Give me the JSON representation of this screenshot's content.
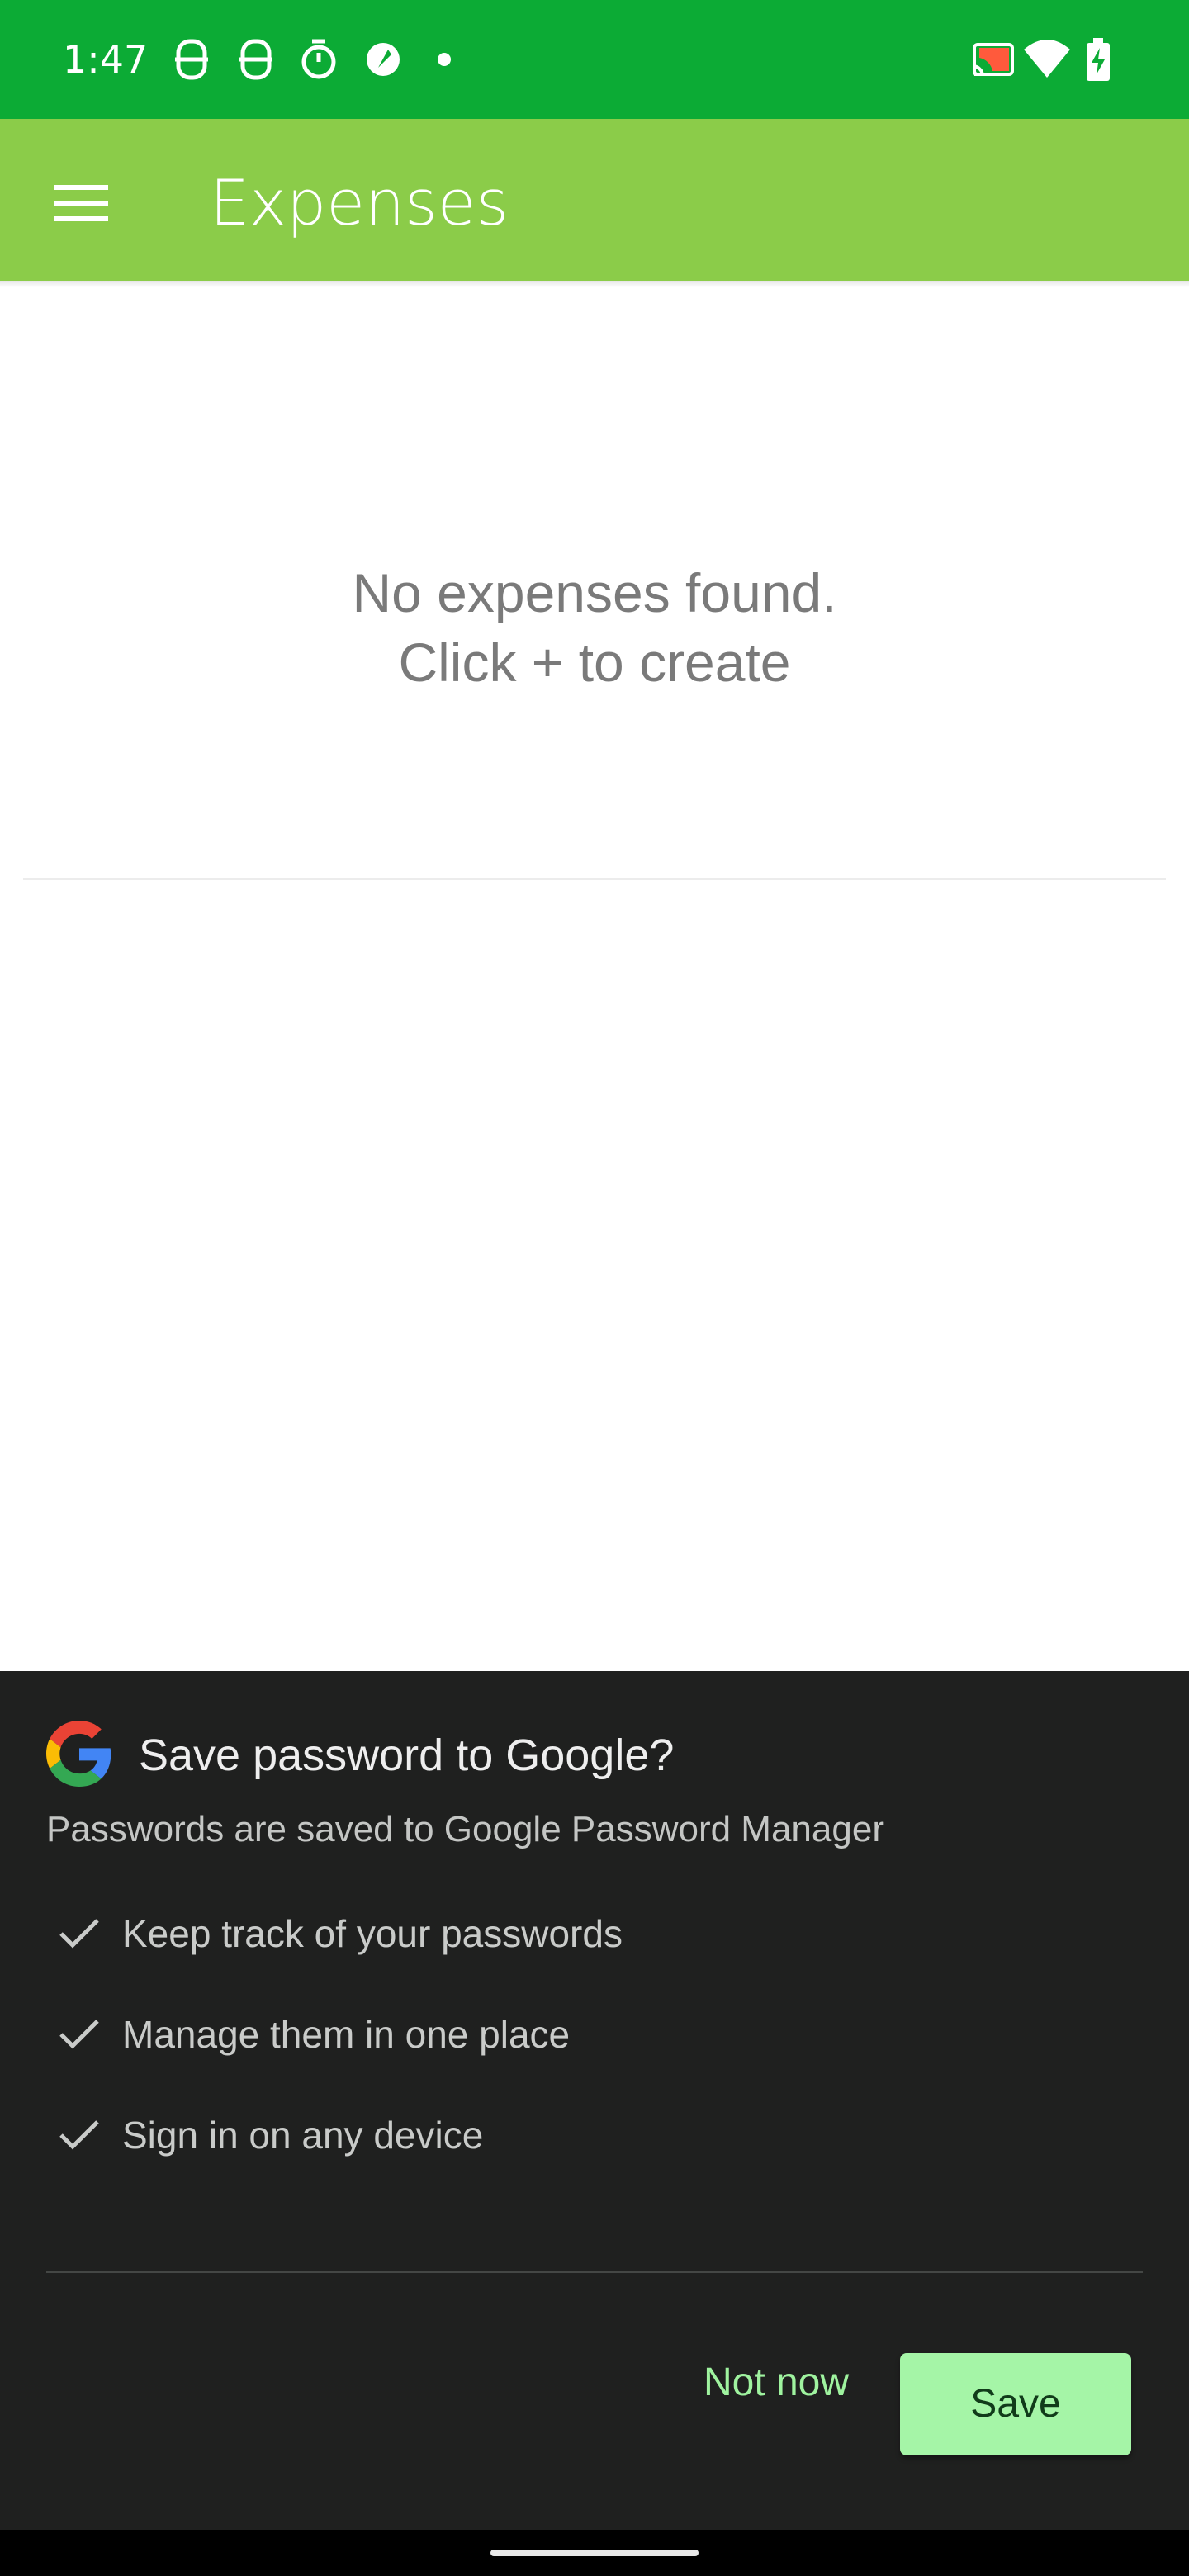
{
  "status_bar": {
    "time": "1:47",
    "background": "#0cab35",
    "icons": [
      "notification-s-icon",
      "notification-s-icon",
      "timer-icon",
      "app-notification-icon",
      "dot-icon",
      "cast-icon",
      "wifi-icon",
      "battery-charging-icon"
    ]
  },
  "app_bar": {
    "title": "Expenses",
    "background": "#8bcc49",
    "menu_icon": "hamburger-menu-icon"
  },
  "empty_state": {
    "line1": "No expenses found.",
    "line2": "Click + to create"
  },
  "password_sheet": {
    "title": "Save password to Google?",
    "subtitle": "Passwords are saved to Google Password Manager",
    "features": [
      "Keep track of your passwords",
      "Manage them in one place",
      "Sign in on any device"
    ],
    "not_now_label": "Not now",
    "save_label": "Save",
    "accent": "#a5f5a7",
    "background": "#1f201f"
  }
}
